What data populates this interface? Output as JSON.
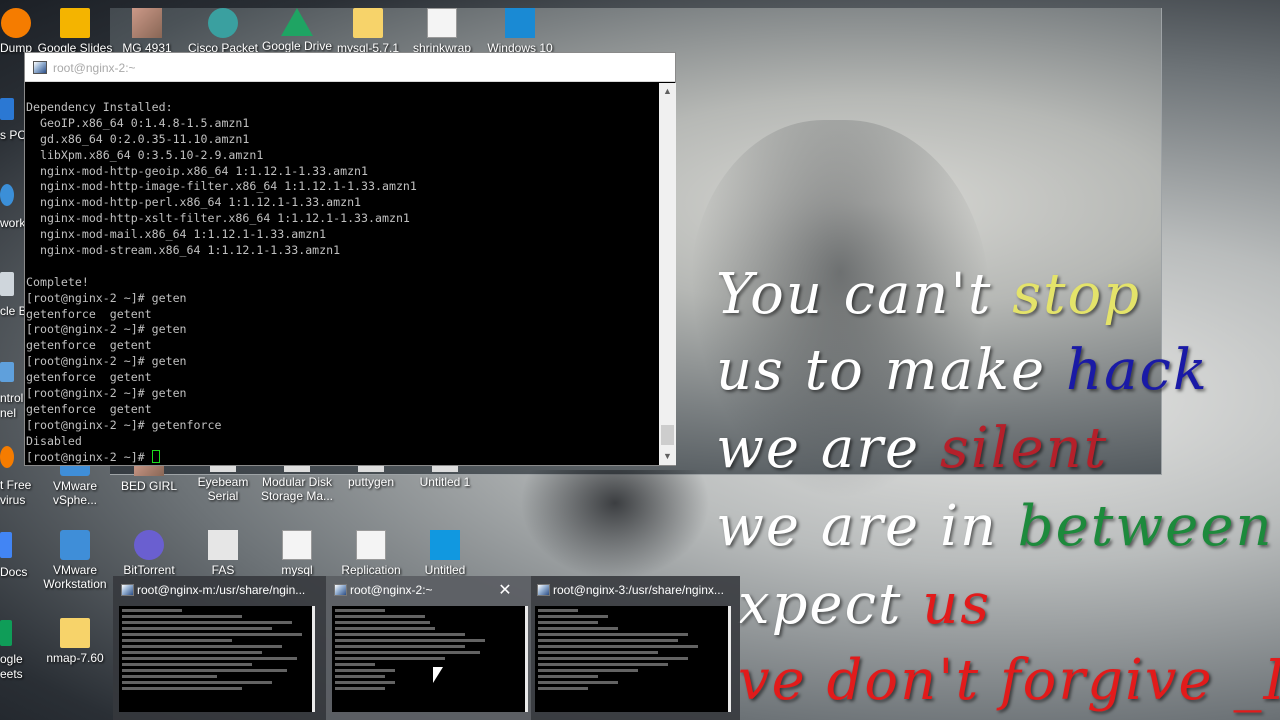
{
  "desktop_icons_top": [
    {
      "label": "Dump",
      "icon": "app-icon"
    },
    {
      "label": "Google Slides",
      "icon": "slides-icon"
    },
    {
      "label": "MG 4931",
      "icon": "photo-icon"
    },
    {
      "label": "Cisco Packet",
      "icon": "cisco-icon"
    },
    {
      "label": "Google Drive",
      "icon": "drive-icon"
    },
    {
      "label": "mysql-5.7.1",
      "icon": "folder-icon"
    },
    {
      "label": "shrinkwrap",
      "icon": "document-icon"
    },
    {
      "label": "Windows 10",
      "icon": "windows-icon"
    }
  ],
  "desktop_edge_labels": [
    "s PC",
    "work",
    "cle Bi",
    "ntrol",
    "nel",
    "t Free",
    "virus",
    "Docs",
    "ogle",
    "eets"
  ],
  "desktop_icons_mid": [
    {
      "label": "VMware vSphe...",
      "icon": "vmware-icon"
    },
    {
      "label": "BED GIRL",
      "icon": "photo-icon"
    },
    {
      "label": "Eyebeam Serial",
      "icon": "app-icon"
    },
    {
      "label": "Modular Disk Storage Ma...",
      "icon": "storage-icon"
    },
    {
      "label": "puttygen",
      "icon": "putty-icon"
    },
    {
      "label": "Untitled 1",
      "icon": "document-icon"
    }
  ],
  "desktop_icons_low": [
    {
      "label": "VMware Workstation",
      "icon": "vmware-icon"
    },
    {
      "label": "BitTorrent",
      "icon": "bittorrent-icon"
    },
    {
      "label": "FAS",
      "icon": "app-icon"
    },
    {
      "label": "mysql",
      "icon": "document-icon"
    },
    {
      "label": "Replication",
      "icon": "document-icon"
    },
    {
      "label": "Untitled",
      "icon": "image-icon"
    }
  ],
  "desktop_icons_bottom": [
    {
      "label": "nmap-7.60",
      "icon": "zip-icon"
    }
  ],
  "putty": {
    "title": "root@nginx-2:~",
    "terminal_lines": [
      "Dependency Installed:",
      "  GeoIP.x86_64 0:1.4.8-1.5.amzn1",
      "  gd.x86_64 0:2.0.35-11.10.amzn1",
      "  libXpm.x86_64 0:3.5.10-2.9.amzn1",
      "  nginx-mod-http-geoip.x86_64 1:1.12.1-1.33.amzn1",
      "  nginx-mod-http-image-filter.x86_64 1:1.12.1-1.33.amzn1",
      "  nginx-mod-http-perl.x86_64 1:1.12.1-1.33.amzn1",
      "  nginx-mod-http-xslt-filter.x86_64 1:1.12.1-1.33.amzn1",
      "  nginx-mod-mail.x86_64 1:1.12.1-1.33.amzn1",
      "  nginx-mod-stream.x86_64 1:1.12.1-1.33.amzn1",
      "",
      "Complete!",
      "[root@nginx-2 ~]# geten",
      "getenforce  getent",
      "[root@nginx-2 ~]# geten",
      "getenforce  getent",
      "[root@nginx-2 ~]# geten",
      "getenforce  getent",
      "[root@nginx-2 ~]# geten",
      "getenforce  getent",
      "[root@nginx-2 ~]# getenforce",
      "Disabled"
    ],
    "prompt": "[root@nginx-2 ~]# "
  },
  "wallpaper_text": {
    "line1": {
      "a": "You can't ",
      "b": "stop"
    },
    "line2": {
      "a": "us to make ",
      "b": "hack"
    },
    "line3": {
      "a": "we are ",
      "b": "silent"
    },
    "line4": {
      "a": "we are in ",
      "b": "between"
    },
    "line5": {
      "a": "xpect ",
      "b": "us"
    },
    "line6": "ve don't forgive _I_"
  },
  "taskbar_previews": [
    {
      "title": "root@nginx-m:/usr/share/ngin...",
      "active": false
    },
    {
      "title": "root@nginx-2:~",
      "active": true
    },
    {
      "title": "root@nginx-3:/usr/share/nginx...",
      "active": false
    }
  ],
  "colors": {
    "yellow_word": "#e4e36a",
    "blue_word": "#1a1aa6",
    "red_word": "#b5202a",
    "green_word": "#1d8a3c",
    "cursor": "#1cdc1c"
  }
}
